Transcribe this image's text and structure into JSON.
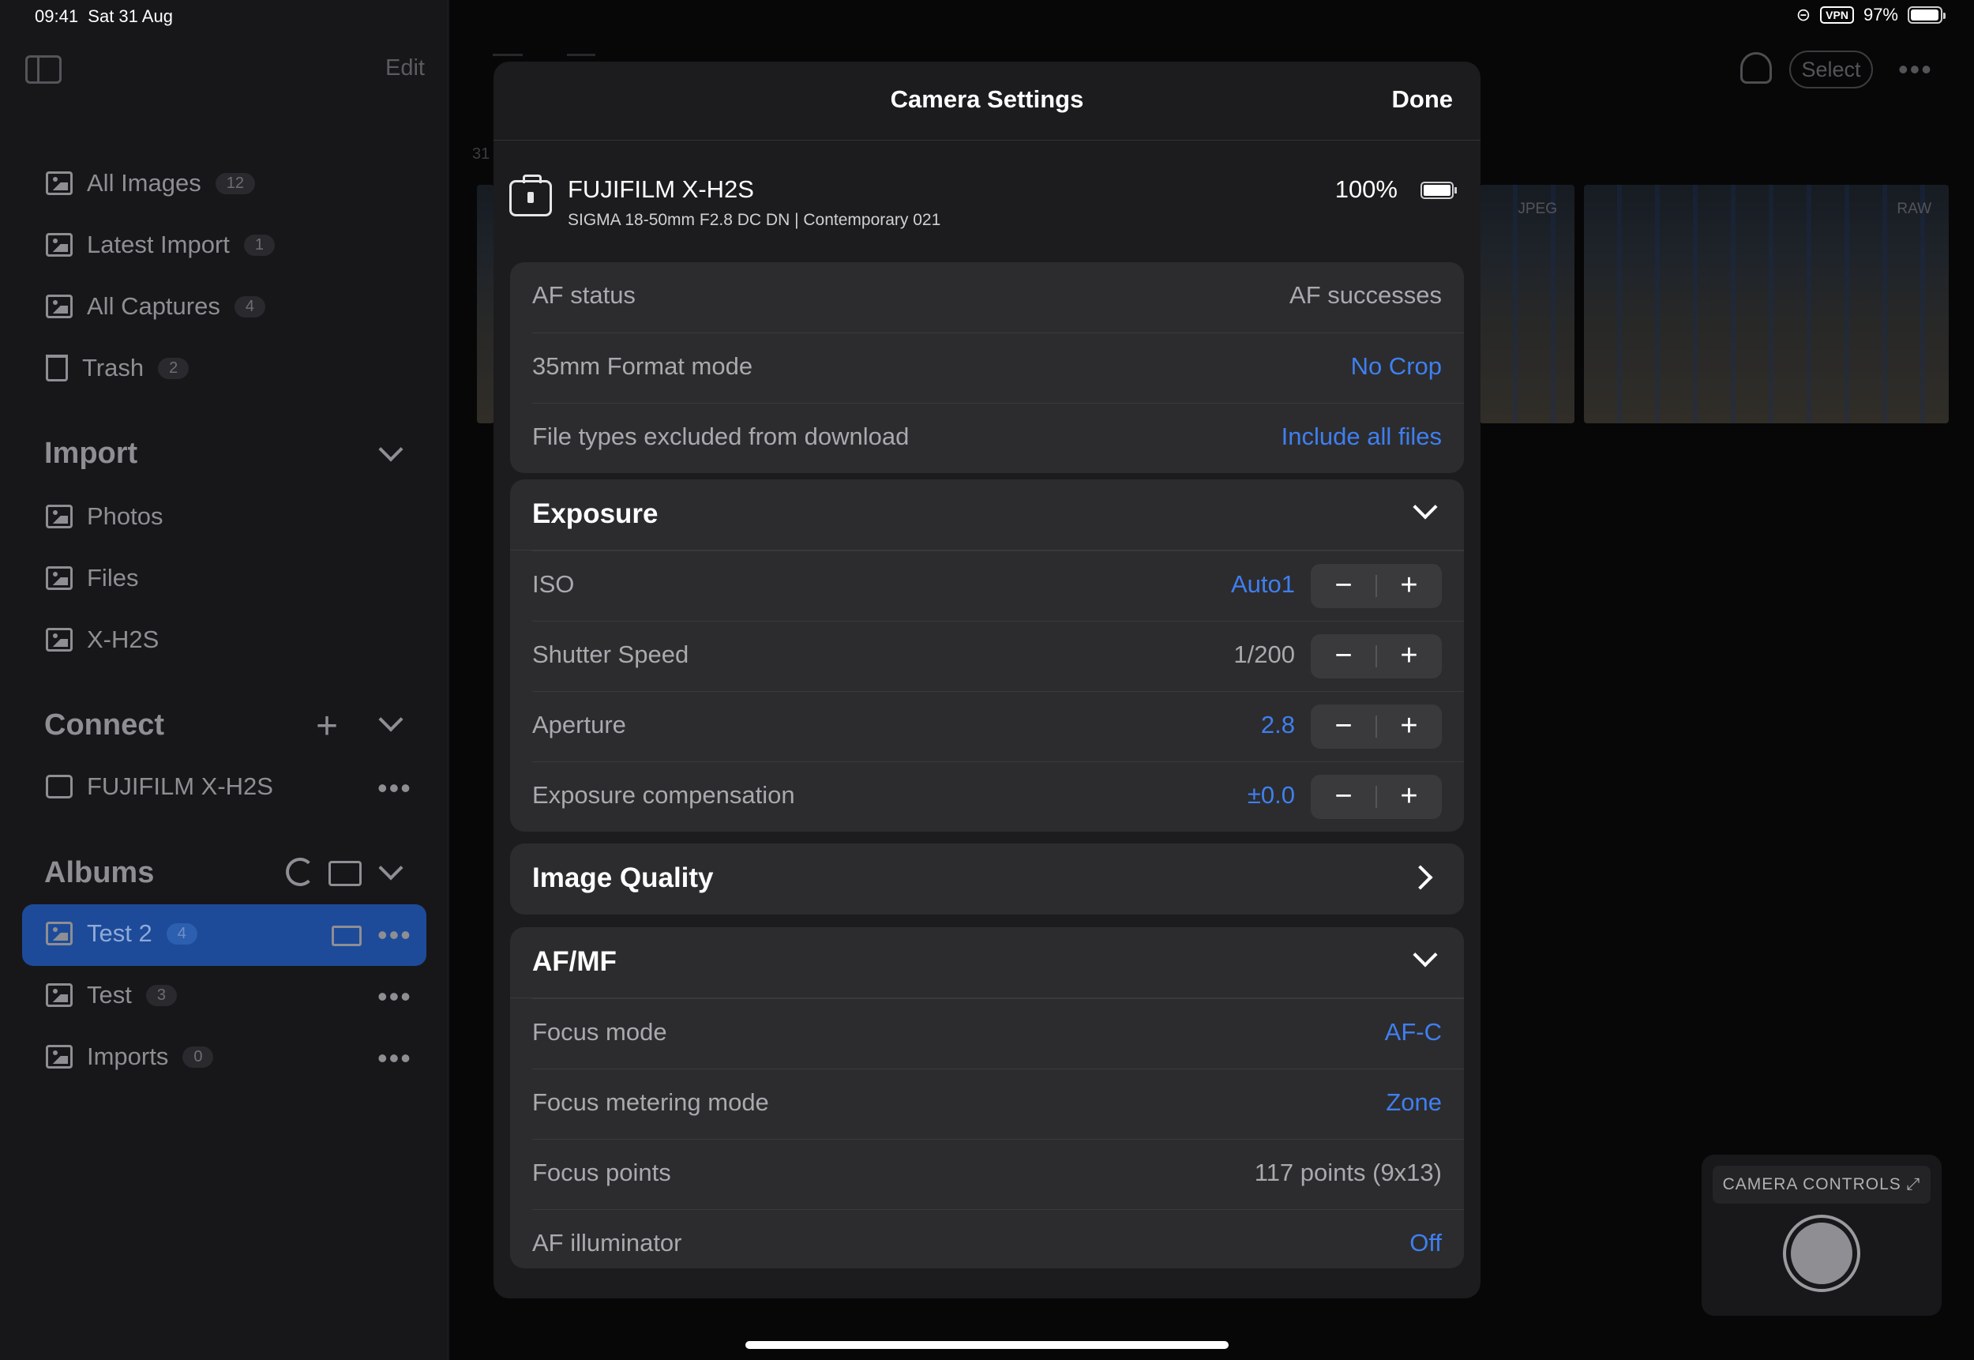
{
  "status_bar": {
    "time": "09:41",
    "date": "Sat 31 Aug",
    "vpn": "VPN",
    "battery": "97%",
    "battery_level": 0.97
  },
  "sidebar": {
    "edit_label": "Edit",
    "library": [
      {
        "label": "All Images",
        "count": "12",
        "icon": "images-icon"
      },
      {
        "label": "Latest Import",
        "count": "1",
        "icon": "import-icon"
      },
      {
        "label": "All Captures",
        "count": "4",
        "icon": "camera-icon"
      },
      {
        "label": "Trash",
        "count": "2",
        "icon": "trash-icon"
      }
    ],
    "import": {
      "title": "Import",
      "items": [
        "Photos",
        "Files",
        "X-H2S"
      ]
    },
    "connect": {
      "title": "Connect",
      "items": [
        "FUJIFILM X-H2S"
      ]
    },
    "albums": {
      "title": "Albums",
      "items": [
        {
          "label": "Test 2",
          "count": "4",
          "selected": true
        },
        {
          "label": "Test",
          "count": "3"
        },
        {
          "label": "Imports",
          "count": "0"
        }
      ]
    }
  },
  "main": {
    "select_label": "Select",
    "date_fragment": "31",
    "thumbs": [
      {
        "tag": "JPEG"
      },
      {
        "tag": "RAW"
      }
    ]
  },
  "modal": {
    "title": "Camera Settings",
    "done_label": "Done",
    "camera": {
      "name": "FUJIFILM X-H2S",
      "lens": "SIGMA 18-50mm F2.8 DC DN | Contemporary 021",
      "battery": "100%",
      "battery_level": 1.0
    },
    "general": [
      {
        "label": "AF status",
        "value": "AF successes"
      },
      {
        "label": "35mm Format mode",
        "value": "No Crop"
      },
      {
        "label": "File types excluded from download",
        "value": "Include all files"
      }
    ],
    "exposure": {
      "title": "Exposure",
      "rows": [
        {
          "label": "ISO",
          "value": "Auto1"
        },
        {
          "label": "Shutter Speed",
          "value": "1/200"
        },
        {
          "label": "Aperture",
          "value": "2.8"
        },
        {
          "label": "Exposure compensation",
          "value": "±0.0"
        }
      ]
    },
    "image_quality": {
      "title": "Image Quality"
    },
    "afmf": {
      "title": "AF/MF",
      "rows": [
        {
          "label": "Focus mode",
          "value": "AF-C"
        },
        {
          "label": "Focus metering mode",
          "value": "Zone"
        },
        {
          "label": "Focus points",
          "value": "117 points (9x13)"
        },
        {
          "label": "AF illuminator",
          "value": "Off"
        }
      ]
    }
  },
  "camera_controls": {
    "label": "CAMERA CONTROLS ⤢"
  },
  "colors": {
    "accent": "#3f7ff0",
    "selection": "#1d4b9a",
    "background": "#0d0d0f",
    "panel": "#2c2c2e"
  }
}
